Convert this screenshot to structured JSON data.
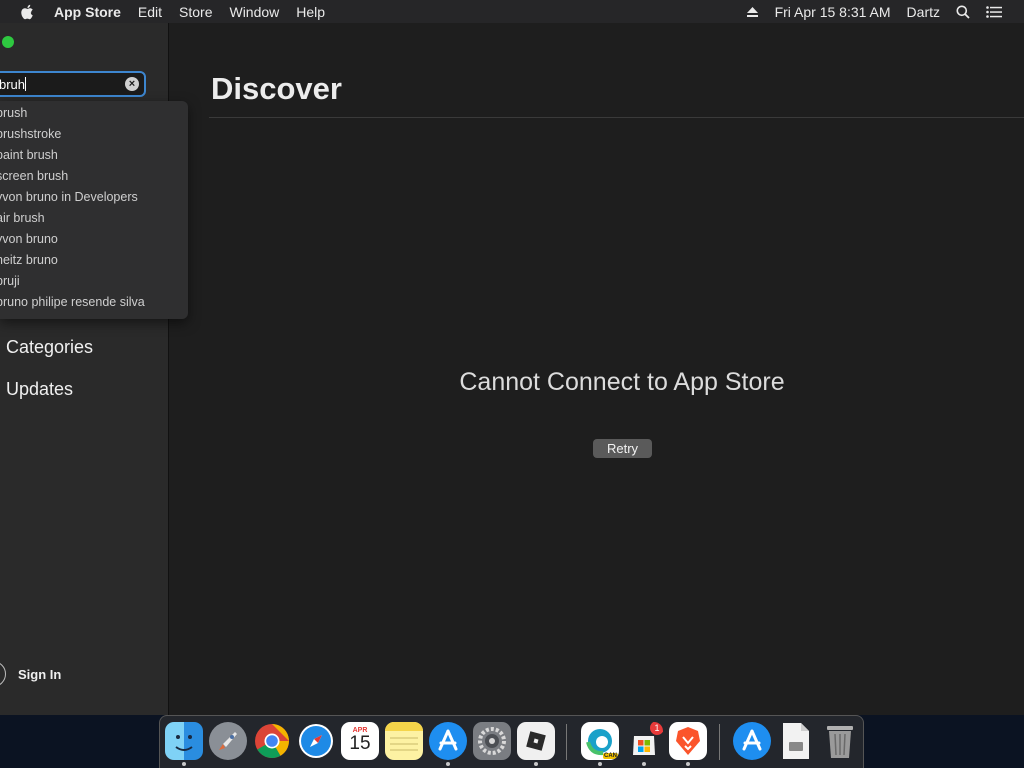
{
  "menubar": {
    "app_name": "App Store",
    "menus": [
      "Edit",
      "Store",
      "Window",
      "Help"
    ],
    "datetime": "Fri Apr 15  8:31 AM",
    "user": "Dartz"
  },
  "sidebar": {
    "search": {
      "value": "bruh"
    },
    "suggestions": [
      "brush",
      "brushstroke",
      "paint brush",
      "screen brush",
      "yvon bruno in Developers",
      "air brush",
      "yvon bruno",
      "heitz bruno",
      "bruji",
      "bruno philipe resende silva"
    ],
    "nav": {
      "categories": "Categories",
      "updates": "Updates"
    },
    "sign_in": "Sign In"
  },
  "main": {
    "title": "Discover",
    "error_message": "Cannot Connect to App Store",
    "retry_label": "Retry"
  },
  "dock": {
    "calendar_month": "APR",
    "calendar_day": "15",
    "edge_tag": "CAN",
    "badge_count": "1",
    "apps": [
      "finder-icon",
      "launchpad-icon",
      "chrome-icon",
      "safari-icon",
      "calendar-icon",
      "notes-icon",
      "app-store-icon",
      "system-preferences-icon",
      "roblox-icon",
      "edge-canary-icon",
      "microsoft-store-icon",
      "brave-icon",
      "downloads-folder-icon",
      "document-icon",
      "trash-icon"
    ]
  },
  "colors": {
    "accent": "#3d86cf",
    "window_bg": "#1e1e1e",
    "sidebar_bg": "#2a2a2a",
    "traffic_green": "#2ec840"
  }
}
